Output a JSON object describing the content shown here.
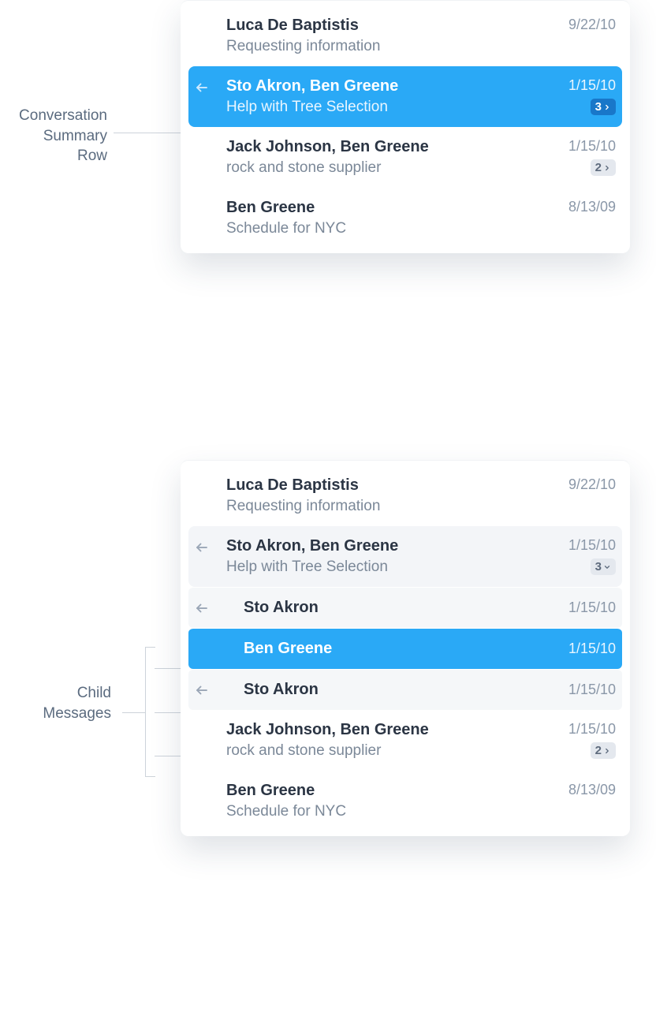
{
  "annotations": {
    "summary_row": "Conversation\nSummary\nRow",
    "children": "Child\nMessages"
  },
  "panel1": {
    "rows": [
      {
        "sender": "Luca De Baptistis",
        "subject": "Requesting information",
        "date": "9/22/10"
      },
      {
        "sender": "Sto Akron, Ben Greene",
        "subject": "Help with Tree Selection",
        "date": "1/15/10",
        "count": "3",
        "selected": true,
        "reply": true
      },
      {
        "sender": "Jack Johnson, Ben Greene",
        "subject": "rock and stone supplier",
        "date": "1/15/10",
        "count": "2"
      },
      {
        "sender": "Ben Greene",
        "subject": "Schedule for NYC",
        "date": "8/13/09"
      }
    ]
  },
  "panel2": {
    "rows": [
      {
        "sender": "Luca De Baptistis",
        "subject": "Requesting information",
        "date": "9/22/10"
      },
      {
        "sender": "Sto Akron, Ben Greene",
        "subject": "Help with Tree Selection",
        "date": "1/15/10",
        "count": "3",
        "expanded": true,
        "reply": true
      },
      {
        "sender": "Jack Johnson, Ben Greene",
        "subject": "rock and stone supplier",
        "date": "1/15/10",
        "count": "2"
      },
      {
        "sender": "Ben Greene",
        "subject": "Schedule for NYC",
        "date": "8/13/09"
      }
    ],
    "children": [
      {
        "name": "Sto Akron",
        "date": "1/15/10",
        "reply": true
      },
      {
        "name": "Ben Greene",
        "date": "1/15/10",
        "selected": true
      },
      {
        "name": "Sto Akron",
        "date": "1/15/10",
        "reply": true
      }
    ]
  }
}
